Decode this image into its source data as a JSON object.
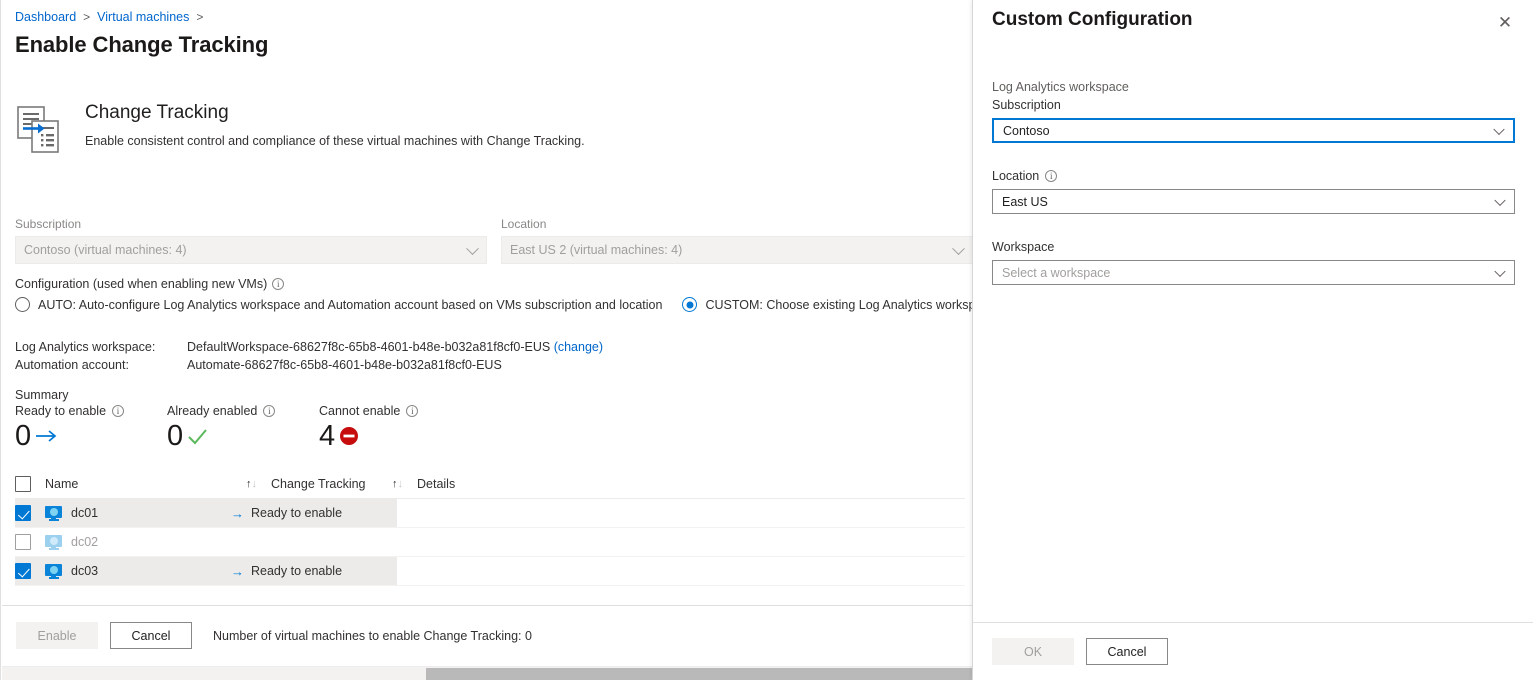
{
  "breadcrumb": {
    "items": [
      "Dashboard",
      "Virtual machines"
    ],
    "separator": ">"
  },
  "page": {
    "title": "Enable Change Tracking"
  },
  "hero": {
    "icon": "change-tracking-icon",
    "title": "Change Tracking",
    "subtitle": "Enable consistent control and compliance of these virtual machines with Change Tracking."
  },
  "filters": {
    "subscription": {
      "label": "Subscription",
      "value": "Contoso (virtual machines: 4)"
    },
    "location": {
      "label": "Location",
      "value": "East US 2 (virtual machines: 4)"
    }
  },
  "configuration": {
    "label": "Configuration (used when enabling new VMs)",
    "info_icon": "info-icon",
    "options": [
      {
        "id": "auto",
        "label": "AUTO: Auto-configure Log Analytics workspace and Automation account based on VMs subscription and location",
        "selected": false
      },
      {
        "id": "custom",
        "label": "CUSTOM: Choose existing Log Analytics workspace and Automation account",
        "selected": true
      }
    ]
  },
  "workspace_info": {
    "rows": [
      {
        "key": "Log Analytics workspace:",
        "value": "DefaultWorkspace-68627f8c-65b8-4601-b48e-b032a81f8cf0-EUS",
        "link": "(change)"
      },
      {
        "key": "Automation account:",
        "value": "Automate-68627f8c-65b8-4601-b48e-b032a81f8cf0-EUS",
        "link": ""
      }
    ]
  },
  "summary": {
    "title": "Summary",
    "cards": [
      {
        "label": "Ready to enable",
        "value": "0",
        "icon": "arrow-right-icon",
        "color": "#0078d4"
      },
      {
        "label": "Already enabled",
        "value": "0",
        "icon": "check-icon",
        "color": "#5cb85c"
      },
      {
        "label": "Cannot enable",
        "value": "4",
        "icon": "blocked-icon",
        "color": "#c60c0c"
      }
    ]
  },
  "table": {
    "columns": [
      {
        "key": "name",
        "label": "Name",
        "sortable": true
      },
      {
        "key": "change_tracking",
        "label": "Change Tracking",
        "sortable": true
      },
      {
        "key": "details",
        "label": "Details",
        "sortable": false
      }
    ],
    "select_all_checked": false,
    "rows": [
      {
        "name": "dc01",
        "checked": true,
        "status": "Ready to enable",
        "status_icon": "arrow-right-icon",
        "details": "",
        "dimmed": false
      },
      {
        "name": "dc02",
        "checked": false,
        "status": "",
        "status_icon": "",
        "details": "",
        "dimmed": true
      },
      {
        "name": "dc03",
        "checked": true,
        "status": "Ready to enable",
        "status_icon": "arrow-right-icon",
        "details": "",
        "dimmed": false
      }
    ]
  },
  "footer": {
    "enable_label": "Enable",
    "cancel_label": "Cancel",
    "note": "Number of virtual machines to enable Change Tracking: 0"
  },
  "panel": {
    "title": "Custom Configuration",
    "close_icon": "close-icon",
    "group_label": "Log Analytics workspace",
    "fields": [
      {
        "id": "subscription",
        "label": "Subscription",
        "value": "Contoso",
        "placeholder": false,
        "focused": true,
        "info": false
      },
      {
        "id": "location",
        "label": "Location",
        "value": "East US",
        "placeholder": false,
        "focused": false,
        "info": true
      },
      {
        "id": "workspace",
        "label": "Workspace",
        "value": "Select a workspace",
        "placeholder": true,
        "focused": false,
        "info": false
      }
    ],
    "ok_label": "OK",
    "cancel_label": "Cancel"
  },
  "colors": {
    "link": "#0066cc",
    "accent": "#0078d4",
    "success": "#5cb85c",
    "error": "#c60c0c"
  }
}
